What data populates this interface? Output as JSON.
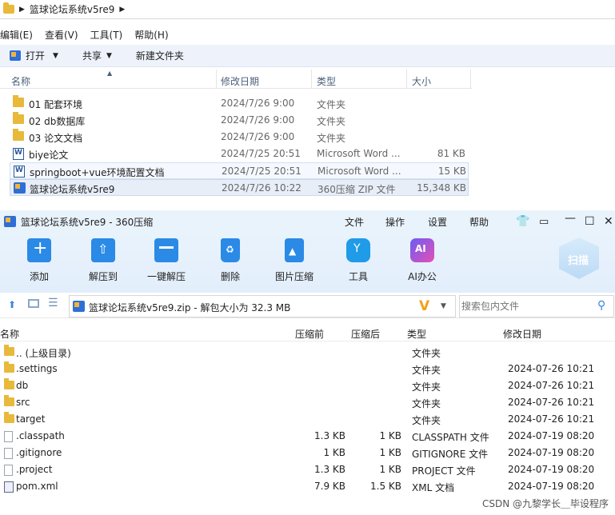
{
  "explorer": {
    "address": [
      "篮球论坛系统v5re9"
    ],
    "menu": [
      "编辑(E)",
      "查看(V)",
      "工具(T)",
      "帮助(H)"
    ],
    "toolbar": {
      "open": "打开",
      "share": "共享",
      "new_folder": "新建文件夹"
    },
    "columns": {
      "name": "名称",
      "date": "修改日期",
      "type": "类型",
      "size": "大小"
    },
    "rows": [
      {
        "name": "01 配套环境",
        "date": "2024/7/26 9:00",
        "type": "文件夹",
        "size": "",
        "icon": "folder-icon"
      },
      {
        "name": "02 db数据库",
        "date": "2024/7/26 9:00",
        "type": "文件夹",
        "size": "",
        "icon": "folder-icon"
      },
      {
        "name": "03 论文文档",
        "date": "2024/7/26 9:00",
        "type": "文件夹",
        "size": "",
        "icon": "folder-icon"
      },
      {
        "name": "biye论文",
        "date": "2024/7/25 20:51",
        "type": "Microsoft Word ...",
        "size": "81 KB",
        "icon": "word-icon"
      },
      {
        "name": "springboot+vue环境配置文档",
        "date": "2024/7/25 20:51",
        "type": "Microsoft Word ...",
        "size": "15 KB",
        "icon": "word-icon"
      },
      {
        "name": "篮球论坛系统v5re9",
        "date": "2024/7/26 10:22",
        "type": "360压缩 ZIP 文件",
        "size": "15,348 KB",
        "icon": "zip-icon"
      }
    ]
  },
  "zip": {
    "title": "篮球论坛系统v5re9 - 360压缩",
    "menu": [
      "文件",
      "操作",
      "设置",
      "帮助"
    ],
    "ribbon": [
      "添加",
      "解压到",
      "一键解压",
      "删除",
      "图片压缩",
      "工具",
      "AI办公"
    ],
    "scan": "扫描",
    "path": "篮球论坛系统v5re9.zip - 解包大小为 32.3 MB",
    "search_placeholder": "搜索包内文件",
    "columns": {
      "name": "名称",
      "before": "压缩前",
      "after": "压缩后",
      "type": "类型",
      "date": "修改日期"
    },
    "rows": [
      {
        "name": ".. (上级目录)",
        "before": "",
        "after": "",
        "type": "文件夹",
        "date": "",
        "icon": "folder-icon"
      },
      {
        "name": ".settings",
        "before": "",
        "after": "",
        "type": "文件夹",
        "date": "2024-07-26 10:21",
        "icon": "folder-icon"
      },
      {
        "name": "db",
        "before": "",
        "after": "",
        "type": "文件夹",
        "date": "2024-07-26 10:21",
        "icon": "folder-icon"
      },
      {
        "name": "src",
        "before": "",
        "after": "",
        "type": "文件夹",
        "date": "2024-07-26 10:21",
        "icon": "folder-icon"
      },
      {
        "name": "target",
        "before": "",
        "after": "",
        "type": "文件夹",
        "date": "2024-07-26 10:21",
        "icon": "folder-icon"
      },
      {
        "name": ".classpath",
        "before": "1.3 KB",
        "after": "1 KB",
        "type": "CLASSPATH 文件",
        "date": "2024-07-19 08:20",
        "icon": "file-icon"
      },
      {
        "name": ".gitignore",
        "before": "1 KB",
        "after": "1 KB",
        "type": "GITIGNORE 文件",
        "date": "2024-07-19 08:20",
        "icon": "file-icon"
      },
      {
        "name": ".project",
        "before": "1.3 KB",
        "after": "1 KB",
        "type": "PROJECT 文件",
        "date": "2024-07-19 08:20",
        "icon": "file-icon"
      },
      {
        "name": "pom.xml",
        "before": "7.9 KB",
        "after": "1.5 KB",
        "type": "XML 文档",
        "date": "2024-07-19 08:20",
        "icon": "xml-icon"
      }
    ]
  },
  "watermark": "CSDN @九黎学长＿毕设程序"
}
